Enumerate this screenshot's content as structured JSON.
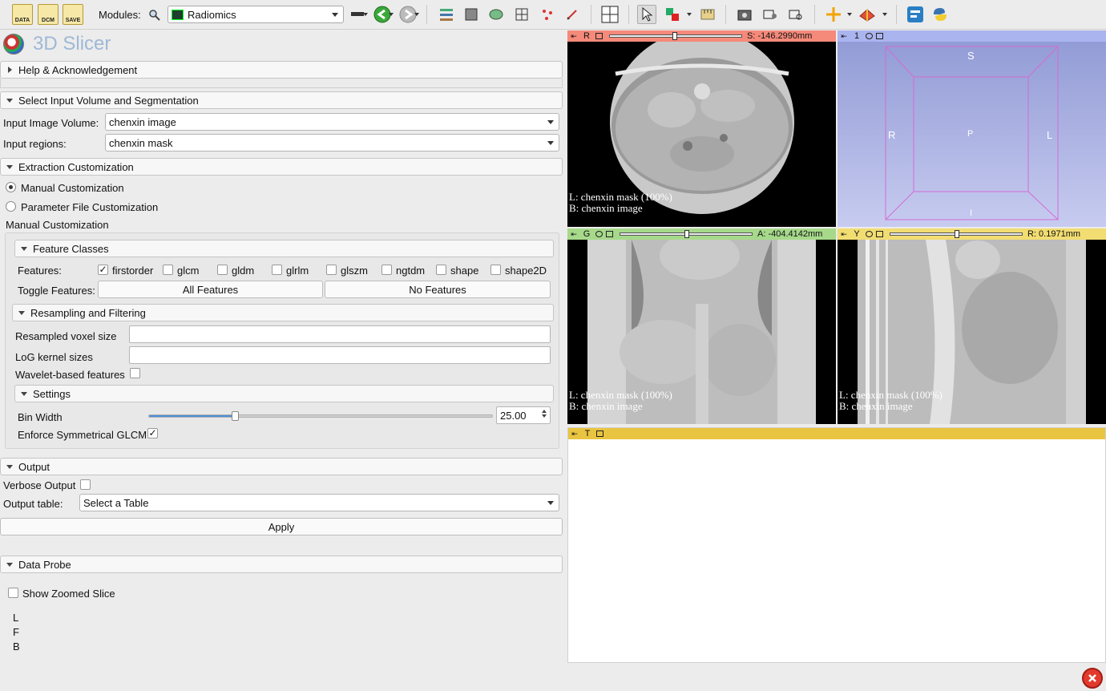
{
  "toolbar": {
    "data_label": "DATA",
    "dcm_label": "DCM",
    "save_label": "SAVE",
    "modules_label": "Modules:",
    "module_selected": "Radiomics"
  },
  "app": {
    "title": "3D Slicer"
  },
  "help_section": {
    "label": "Help & Acknowledgement"
  },
  "input_section": {
    "label": "Select Input Volume and Segmentation",
    "image_volume_label": "Input Image Volume:",
    "image_volume_value": "chenxin image",
    "regions_label": "Input regions:",
    "regions_value": "chenxin mask"
  },
  "extraction": {
    "label": "Extraction Customization",
    "manual_option": "Manual Customization",
    "param_option": "Parameter File Customization",
    "manual_group_title": "Manual Customization",
    "feature_classes_label": "Feature Classes",
    "features_label": "Features:",
    "features": [
      {
        "name": "firstorder",
        "checked": true
      },
      {
        "name": "glcm",
        "checked": false
      },
      {
        "name": "gldm",
        "checked": false
      },
      {
        "name": "glrlm",
        "checked": false
      },
      {
        "name": "glszm",
        "checked": false
      },
      {
        "name": "ngtdm",
        "checked": false
      },
      {
        "name": "shape",
        "checked": false
      },
      {
        "name": "shape2D",
        "checked": false
      }
    ],
    "toggle_label": "Toggle Features:",
    "all_features": "All Features",
    "no_features": "No Features",
    "resampling_label": "Resampling and Filtering",
    "voxel_label": "Resampled voxel size",
    "log_label": "LoG kernel sizes",
    "wavelet_label": "Wavelet-based features",
    "settings_label": "Settings",
    "bin_width_label": "Bin Width",
    "bin_width_value": "25.00",
    "bin_width_fraction": 0.25,
    "symmetrical_label": "Enforce Symmetrical GLCM"
  },
  "output": {
    "label": "Output",
    "verbose_label": "Verbose Output",
    "table_label": "Output table:",
    "table_value": "Select a Table",
    "apply_label": "Apply"
  },
  "data_probe": {
    "label": "Data Probe",
    "zoomed_label": "Show Zoomed Slice",
    "probe_lines": [
      "L",
      "F",
      "B"
    ]
  },
  "views": {
    "red": {
      "letter": "R",
      "offset": "S: -146.2990mm",
      "line1": "L: chenxin mask (100%)",
      "line2": "B: chenxin image",
      "color": "#f5897a",
      "slider_fraction": 0.5
    },
    "threed": {
      "letter": "1",
      "label_s": "S",
      "label_r": "R",
      "label_p": "P",
      "label_l": "L",
      "label_i": "I",
      "color": "#aab4ee"
    },
    "green": {
      "letter": "G",
      "offset": "A: -404.4142mm",
      "line1": "L: chenxin mask (100%)",
      "line2": "B: chenxin image",
      "color": "#a6d98a",
      "slider_fraction": 0.5
    },
    "yellow": {
      "letter": "Y",
      "offset": "R: 0.1971mm",
      "line1": "L: chenxin mask (100%)",
      "line2": "B: chenxin image",
      "color": "#f1dd72",
      "slider_fraction": 0.5
    },
    "table": {
      "letter": "T",
      "color": "#e9c440"
    }
  }
}
